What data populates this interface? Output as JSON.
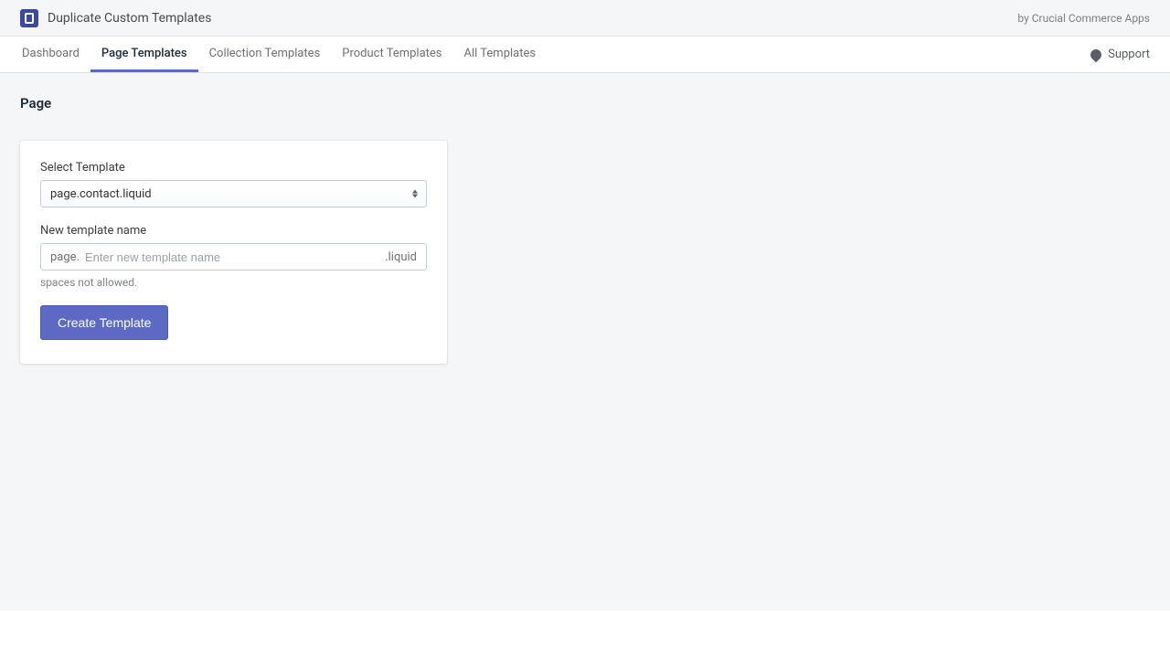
{
  "header": {
    "app_title": "Duplicate Custom Templates",
    "vendor": "by Crucial Commerce Apps"
  },
  "nav": {
    "tabs": [
      {
        "label": "Dashboard",
        "active": false
      },
      {
        "label": "Page Templates",
        "active": true
      },
      {
        "label": "Collection Templates",
        "active": false
      },
      {
        "label": "Product Templates",
        "active": false
      },
      {
        "label": "All Templates",
        "active": false
      }
    ],
    "support_label": "Support"
  },
  "page": {
    "title": "Page"
  },
  "form": {
    "select_label": "Select Template",
    "select_value": "page.contact.liquid",
    "name_label": "New template name",
    "name_prefix": "page.",
    "name_placeholder": "Enter new template name",
    "name_suffix": ".liquid",
    "help_text": "spaces not allowed.",
    "submit_label": "Create Template"
  }
}
